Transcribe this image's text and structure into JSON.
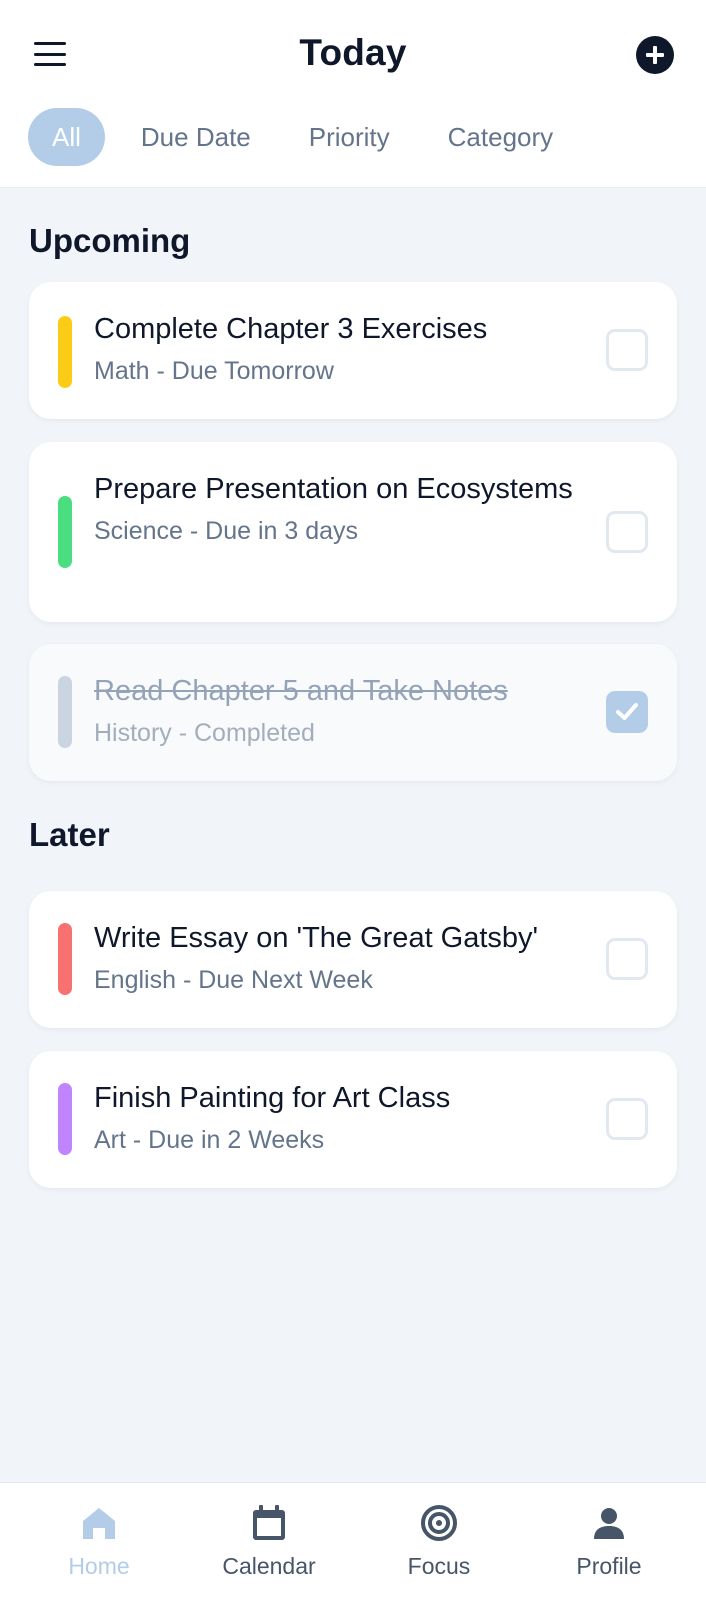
{
  "header": {
    "title": "Today",
    "menu_icon": "hamburger-menu-icon",
    "add_icon": "plus-circle-icon"
  },
  "tabs": [
    {
      "label": "All",
      "active": true
    },
    {
      "label": "Due Date",
      "active": false
    },
    {
      "label": "Priority",
      "active": false
    },
    {
      "label": "Category",
      "active": false
    }
  ],
  "sections": [
    {
      "title": "Upcoming",
      "tasks": [
        {
          "title": "Complete Chapter 3 Exercises",
          "subtitle": "Math - Due Tomorrow",
          "color": "#facc15",
          "completed": false
        },
        {
          "title": "Prepare Presentation on Ecosystems",
          "subtitle": "Science - Due in 3 days",
          "color": "#4ade80",
          "completed": false
        },
        {
          "title": "Read Chapter 5 and Take Notes",
          "subtitle": "History - Completed",
          "color": "#cbd5e1",
          "completed": true
        }
      ]
    },
    {
      "title": "Later",
      "tasks": [
        {
          "title": "Write Essay on 'The Great Gatsby'",
          "subtitle": "English - Due Next Week",
          "color": "#f87171",
          "completed": false
        },
        {
          "title": "Finish Painting for Art Class",
          "subtitle": "Art - Due in 2 Weeks",
          "color": "#c084fc",
          "completed": false
        }
      ]
    }
  ],
  "bottom_nav": [
    {
      "label": "Home",
      "icon": "home-icon",
      "active": true
    },
    {
      "label": "Calendar",
      "icon": "calendar-icon",
      "active": false
    },
    {
      "label": "Focus",
      "icon": "target-icon",
      "active": false
    },
    {
      "label": "Profile",
      "icon": "user-icon",
      "active": false
    }
  ],
  "colors": {
    "accent": "#b3cde8",
    "background": "#f1f5f9",
    "text_primary": "#0f172a",
    "text_secondary": "#64748b"
  }
}
